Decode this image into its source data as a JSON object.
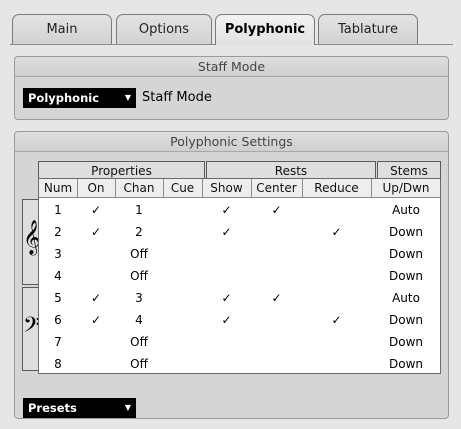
{
  "tabs": [
    "Main",
    "Options",
    "Polyphonic",
    "Tablature"
  ],
  "staff_mode": {
    "header": "Staff Mode",
    "dropdown_value": "Polyphonic",
    "label": "Staff Mode"
  },
  "poly_settings": {
    "header": "Polyphonic Settings",
    "groups": {
      "properties": "Properties",
      "rests": "Rests",
      "stems": "Stems"
    },
    "columns": [
      "Num",
      "On",
      "Chan",
      "Cue",
      "Show",
      "Center",
      "Reduce",
      "Up/Dwn"
    ],
    "rows": [
      [
        "1",
        "✓",
        "1",
        "",
        "✓",
        "✓",
        "",
        "Auto"
      ],
      [
        "2",
        "✓",
        "2",
        "",
        "✓",
        "",
        "✓",
        "Down"
      ],
      [
        "3",
        "",
        "Off",
        "",
        "",
        "",
        "",
        "Down"
      ],
      [
        "4",
        "",
        "Off",
        "",
        "",
        "",
        "",
        "Down"
      ],
      [
        "5",
        "✓",
        "3",
        "",
        "✓",
        "✓",
        "",
        "Auto"
      ],
      [
        "6",
        "✓",
        "4",
        "",
        "✓",
        "",
        "✓",
        "Down"
      ],
      [
        "7",
        "",
        "Off",
        "",
        "",
        "",
        "",
        "Down"
      ],
      [
        "8",
        "",
        "Off",
        "",
        "",
        "",
        "",
        "Down"
      ]
    ]
  },
  "presets": {
    "label": "Presets"
  }
}
